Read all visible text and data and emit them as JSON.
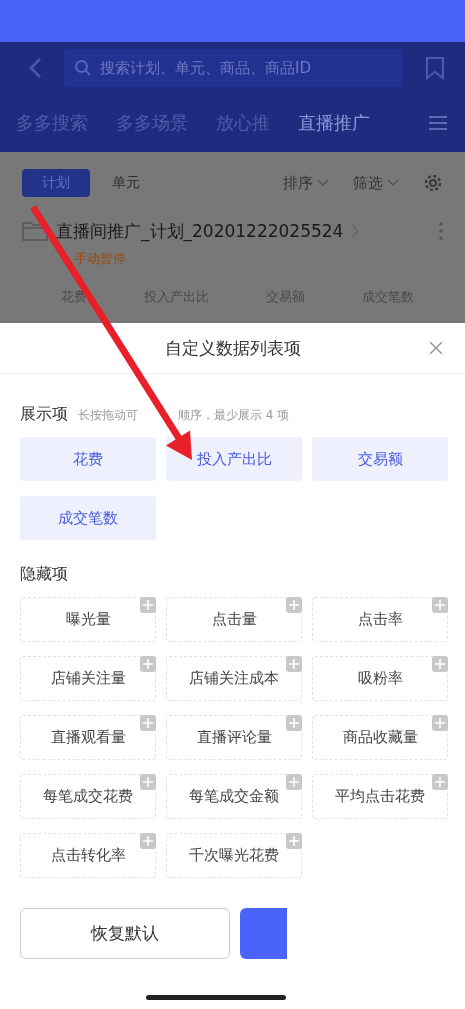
{
  "header": {
    "search": {
      "placeholder": "搜索计划、单元、商品、商品ID"
    }
  },
  "tabs": [
    {
      "label": "多多搜索",
      "selected": false
    },
    {
      "label": "多多场景",
      "selected": false
    },
    {
      "label": "放心推",
      "selected": false
    },
    {
      "label": "直播推广",
      "selected": true
    }
  ],
  "subtabs": [
    {
      "label": "计划",
      "selected": true
    },
    {
      "label": "单元",
      "selected": false
    }
  ],
  "sort": "排序",
  "filter": "筛选",
  "plan": {
    "name": "直播间推广_计划_20201222025524",
    "status": "手动暂停",
    "columns": [
      "花费",
      "投入产出比",
      "交易额",
      "成交笔数"
    ]
  },
  "dialog": {
    "title": "自定义数据列表项",
    "shown_title": "展示项",
    "shown_hint_parts": [
      "长按拖动可",
      "顺序，最少展示 4 项"
    ],
    "shown_items": [
      "花费",
      "投入产出比",
      "交易额",
      "成交笔数"
    ],
    "hidden_title": "隐藏项",
    "hidden_items": [
      "曝光量",
      "点击量",
      "点击率",
      "店铺关注量",
      "店铺关注成本",
      "吸粉率",
      "直播观看量",
      "直播评论量",
      "商品收藏量",
      "每笔成交花费",
      "每笔成交金额",
      "平均点击花费",
      "点击转化率",
      "千次曝光花费"
    ],
    "reset_button": "恢复默认"
  }
}
